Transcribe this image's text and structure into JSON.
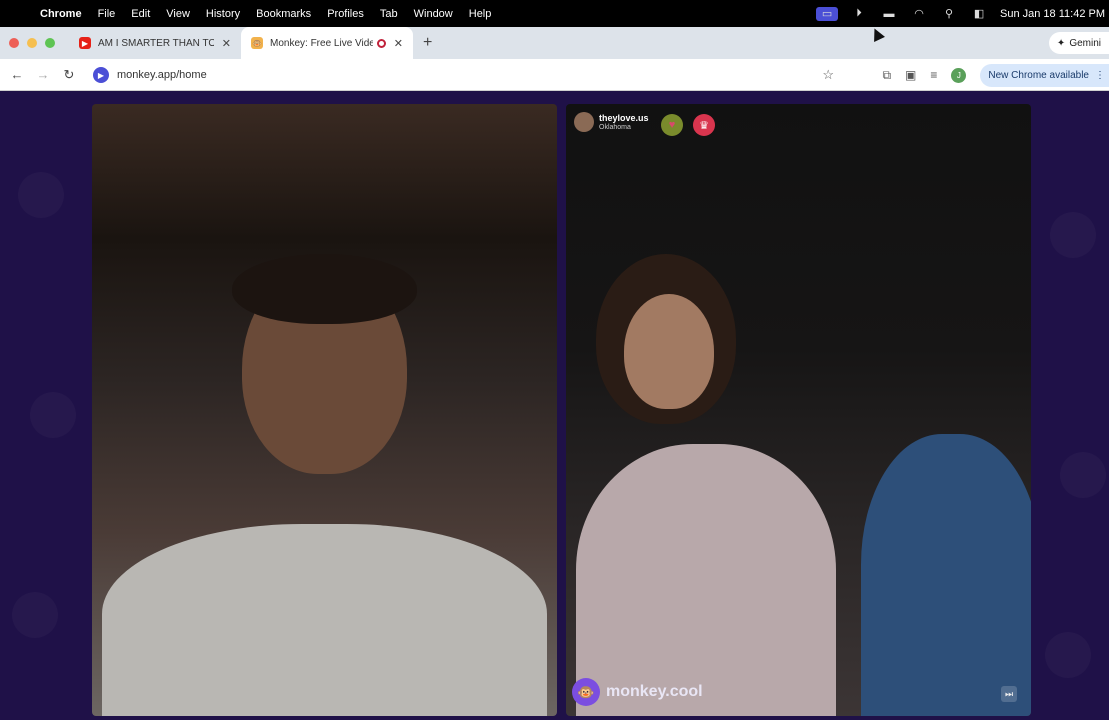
{
  "menubar": {
    "app": "Chrome",
    "items": [
      "File",
      "Edit",
      "View",
      "History",
      "Bookmarks",
      "Profiles",
      "Tab",
      "Window",
      "Help"
    ],
    "clock": "Sun Jan 18  11:42 PM"
  },
  "tabs": [
    {
      "title": "AM I SMARTER THAN TOGI?",
      "favicon": "youtube-icon",
      "color": "#e62117"
    },
    {
      "title": "Monkey: Free Live Video Chat",
      "favicon": "monkey-icon",
      "color": "#f2b24c"
    }
  ],
  "gemini_label": "Gemini",
  "address_bar": {
    "url": "monkey.app/home"
  },
  "update_label": "New Chrome available",
  "profile_initial": "J",
  "remote_user": {
    "name": "theylove.us",
    "location": "Oklahoma"
  },
  "brand": {
    "text": "monkey.cool"
  },
  "colors": {
    "accent": "#4b4fd6",
    "page_bg": "#1f1148",
    "brand_purple": "#7b4ee0"
  }
}
